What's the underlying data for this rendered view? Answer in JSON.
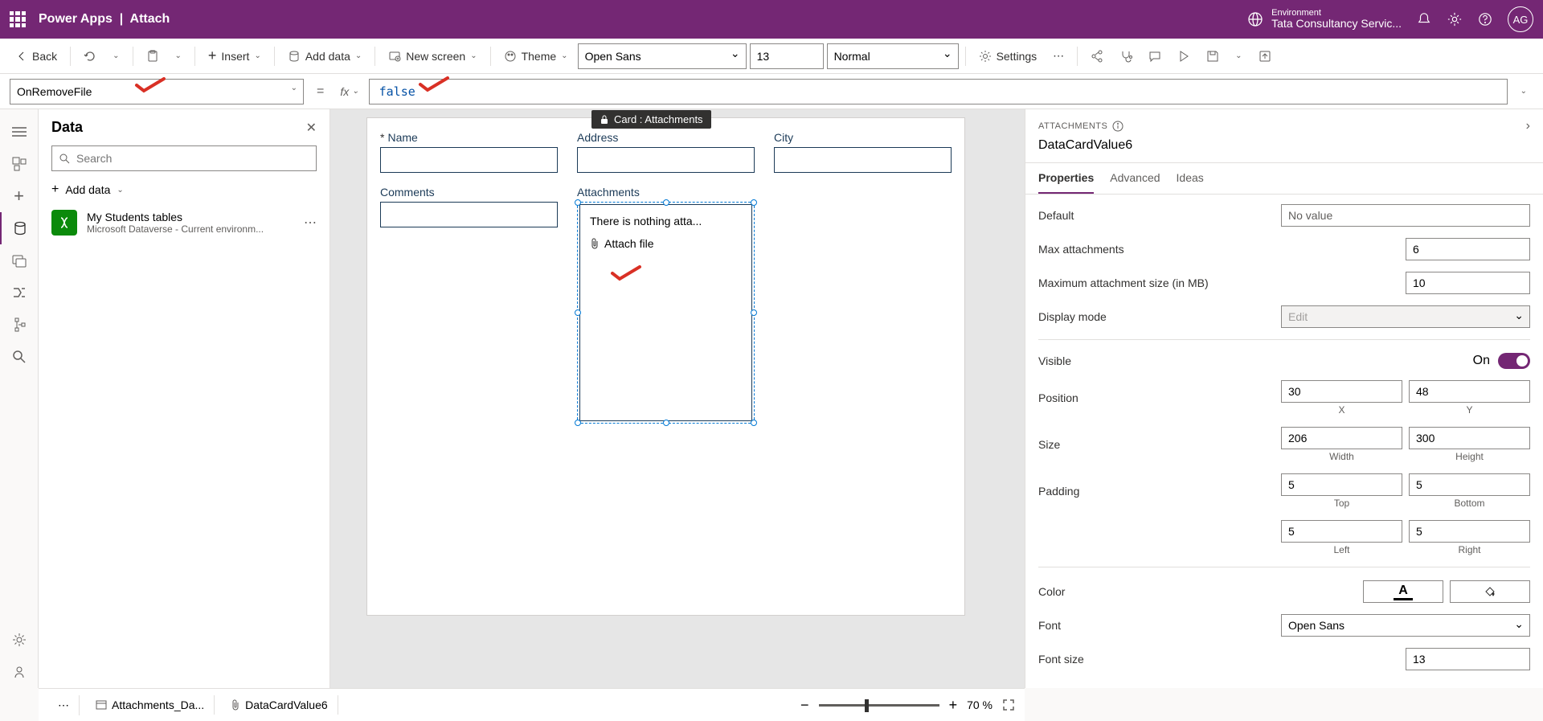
{
  "header": {
    "app": "Power Apps",
    "page": "Attach",
    "env_label": "Environment",
    "env_name": "Tata Consultancy Servic...",
    "avatar": "AG"
  },
  "toolbar": {
    "back": "Back",
    "insert": "Insert",
    "add_data": "Add data",
    "new_screen": "New screen",
    "theme": "Theme",
    "font": "Open Sans",
    "font_size": "13",
    "font_weight": "Normal",
    "settings": "Settings"
  },
  "formula": {
    "property": "OnRemoveFile",
    "value": "false"
  },
  "data_panel": {
    "title": "Data",
    "search_placeholder": "Search",
    "add_data": "Add data",
    "items": [
      {
        "name": "My Students tables",
        "sub": "Microsoft Dataverse - Current environm..."
      }
    ]
  },
  "canvas": {
    "fields": {
      "name": "Name",
      "address": "Address",
      "city": "City",
      "comments": "Comments",
      "attachments": "Attachments"
    },
    "tooltip": "Card : Attachments",
    "attach_empty": "There is nothing atta...",
    "attach_file": "Attach file"
  },
  "props": {
    "category": "ATTACHMENTS",
    "control_name": "DataCardValue6",
    "tabs": {
      "properties": "Properties",
      "advanced": "Advanced",
      "ideas": "Ideas"
    },
    "default_label": "Default",
    "default_val": "No value",
    "max_attach_label": "Max attachments",
    "max_attach_val": "6",
    "max_size_label": "Maximum attachment size (in MB)",
    "max_size_val": "10",
    "display_mode_label": "Display mode",
    "display_mode_val": "Edit",
    "visible_label": "Visible",
    "visible_on": "On",
    "position_label": "Position",
    "pos_x": "30",
    "pos_y": "48",
    "x_label": "X",
    "y_label": "Y",
    "size_label": "Size",
    "width": "206",
    "height": "300",
    "width_label": "Width",
    "height_label": "Height",
    "padding_label": "Padding",
    "pad_top": "5",
    "pad_bottom": "5",
    "pad_left": "5",
    "pad_right": "5",
    "top_label": "Top",
    "bottom_label": "Bottom",
    "left_label": "Left",
    "right_label": "Right",
    "color_label": "Color",
    "font_label": "Font",
    "font_val": "Open Sans",
    "font_size_label": "Font size",
    "font_size_val": "13"
  },
  "breadcrumb": {
    "l1": "Attachments_Da...",
    "l2": "DataCardValue6"
  },
  "zoom": "70  %"
}
